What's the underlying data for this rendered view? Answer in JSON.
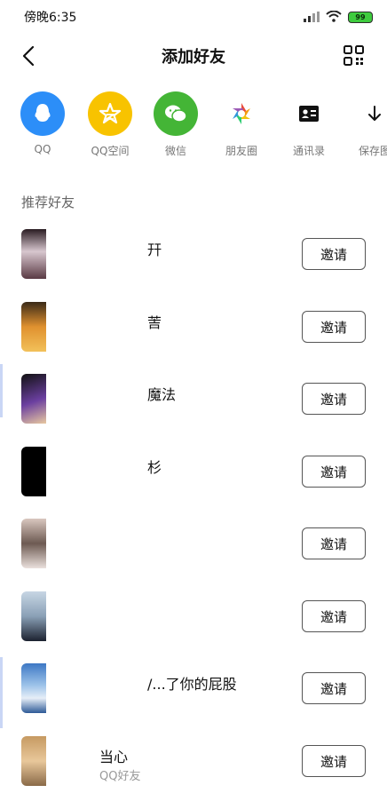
{
  "status_bar": {
    "time": "傍晚6:35",
    "battery": "99"
  },
  "header": {
    "title": "添加好友"
  },
  "share": [
    {
      "label": "QQ",
      "icon": "qq-icon",
      "color": "#2c8ef8"
    },
    {
      "label": "QQ空间",
      "icon": "qzone-icon",
      "color": "#f8c300"
    },
    {
      "label": "微信",
      "icon": "wechat-icon",
      "color": "#44b536"
    },
    {
      "label": "朋友圈",
      "icon": "moments-icon",
      "color": ""
    },
    {
      "label": "通讯录",
      "icon": "contacts-icon",
      "color": ""
    },
    {
      "label": "保存图",
      "icon": "download-icon",
      "color": ""
    }
  ],
  "section_title": "推荐好友",
  "invite_label": "邀请",
  "friends": [
    {
      "name": "幵",
      "sub": ""
    },
    {
      "name": "䓀",
      "sub": ""
    },
    {
      "name": "魔法",
      "sub": ""
    },
    {
      "name": "杉",
      "sub": ""
    },
    {
      "name": "",
      "sub": ""
    },
    {
      "name": "",
      "sub": ""
    },
    {
      "name": "/...了你的屁股",
      "sub": ""
    },
    {
      "name": "当心",
      "sub": "QQ好友"
    }
  ]
}
